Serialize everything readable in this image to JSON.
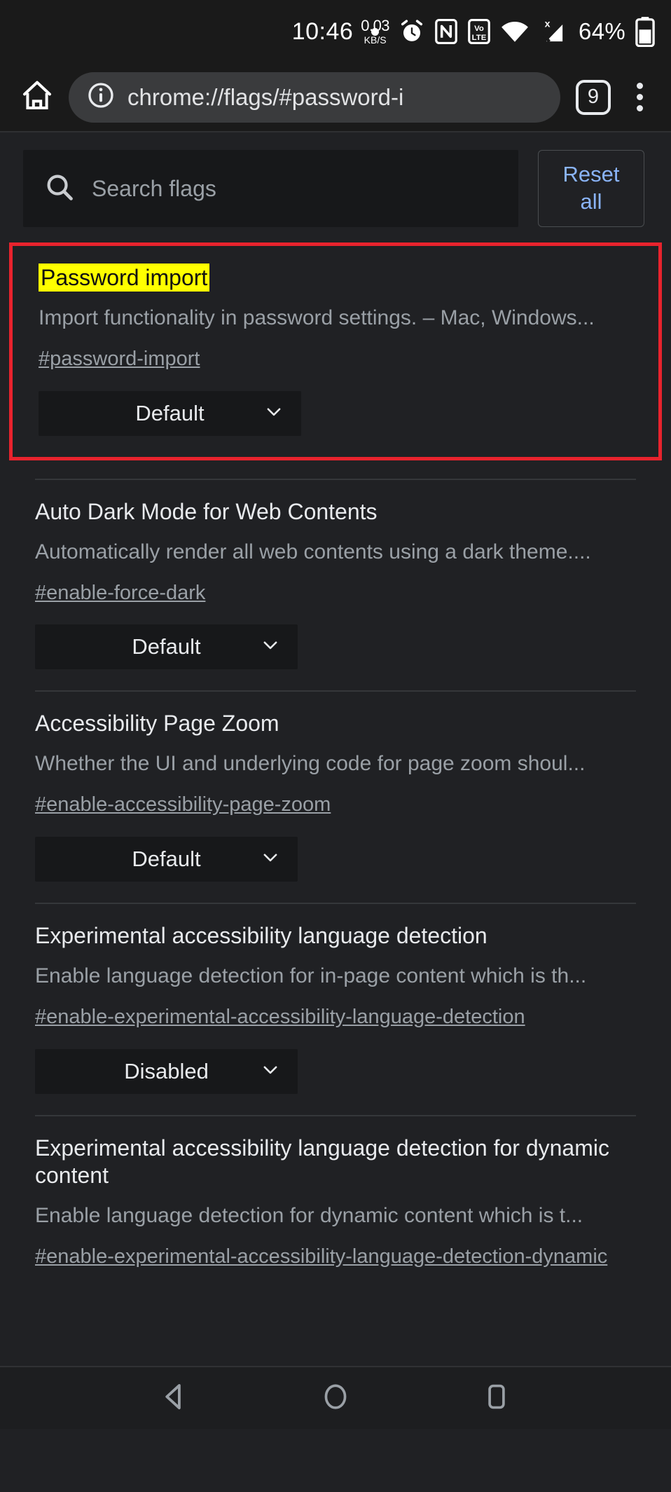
{
  "status_bar": {
    "clock": "10:46",
    "net_speed_value": "0.03",
    "net_speed_unit": "KB/S",
    "battery_percent": "64%",
    "icons": [
      "notification-dot",
      "network-speed",
      "alarm-icon",
      "nfc-icon",
      "volte-icon",
      "wifi-icon",
      "cellular-signal-icon",
      "battery-icon"
    ]
  },
  "toolbar": {
    "url": "chrome://flags/#password-i",
    "tab_count": "9",
    "home_icon": "home-icon",
    "info_icon": "page-info-icon",
    "menu_icon": "overflow-menu-icon"
  },
  "search": {
    "placeholder": "Search flags",
    "reset_line1": "Reset",
    "reset_line2": "all",
    "accent_color": "#8ab4f8"
  },
  "highlight": {
    "border_color": "#e8232d",
    "mark_color": "#ffff00"
  },
  "flags": [
    {
      "title": "Password import",
      "description": "Import functionality in password settings. – Mac, Windows...",
      "permalink": "#password-import",
      "value": "Default",
      "highlighted": true
    },
    {
      "title": "Auto Dark Mode for Web Contents",
      "description": "Automatically render all web contents using a dark theme....",
      "permalink": "#enable-force-dark",
      "value": "Default",
      "highlighted": false
    },
    {
      "title": "Accessibility Page Zoom",
      "description": "Whether the UI and underlying code for page zoom shoul...",
      "permalink": "#enable-accessibility-page-zoom",
      "value": "Default",
      "highlighted": false
    },
    {
      "title": "Experimental accessibility language detection",
      "description": "Enable language detection for in-page content which is th...",
      "permalink": "#enable-experimental-accessibility-language-detection",
      "value": "Disabled",
      "highlighted": false
    },
    {
      "title": "Experimental accessibility language detection for dynamic content",
      "description": "Enable language detection for dynamic content which is t...",
      "permalink": "#enable-experimental-accessibility-language-detection-dynamic",
      "value": "",
      "highlighted": false
    }
  ],
  "nav_bar": {
    "back": "back-triangle-icon",
    "home": "home-circle-icon",
    "recents": "recents-square-icon"
  }
}
